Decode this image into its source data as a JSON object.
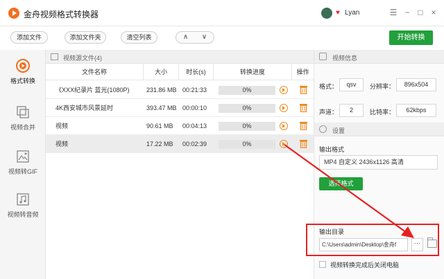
{
  "window": {
    "title": "金舟视频格式转换器",
    "username": "Lyan",
    "minimize": "−",
    "maximize": "□",
    "close": "×",
    "menu": "☰"
  },
  "toolbar": {
    "add_file": "添加文件",
    "add_folder": "添加文件夹",
    "clear_list": "清空列表",
    "move_up": "∧",
    "move_down": "∨",
    "start_convert": "开始转换"
  },
  "sidebar": {
    "items": [
      {
        "label": "格式转换",
        "icon": "convert-icon"
      },
      {
        "label": "视频合并",
        "icon": "merge-icon"
      },
      {
        "label": "视频转GIF",
        "icon": "gif-icon"
      },
      {
        "label": "视频转音频",
        "icon": "audio-icon"
      }
    ]
  },
  "source_list": {
    "header": "视频源文件(4)",
    "columns": [
      "文件名称",
      "大小",
      "时长(s)",
      "转换进度",
      "操作"
    ],
    "rows": [
      {
        "name": "《XXX纪录片 蓝光(1080P)",
        "size": "231.86 MB",
        "duration": "00:21:33",
        "progress": "0%"
      },
      {
        "name": "4K西安城市风景延时",
        "size": "393.47 MB",
        "duration": "00:00:10",
        "progress": "0%"
      },
      {
        "name": "视频",
        "size": "90.61 MB",
        "duration": "00:04:13",
        "progress": "0%"
      },
      {
        "name": "视频",
        "size": "17.22 MB",
        "duration": "00:02:39",
        "progress": "0%"
      }
    ]
  },
  "video_info": {
    "header": "视频信息",
    "format_label": "格式：",
    "format_value": "qsv",
    "resolution_label": "分辨率：",
    "resolution_value": "896x504",
    "channel_label": "声道：",
    "channel_value": "2",
    "bitrate_label": "比特率：",
    "bitrate_value": "62kbps"
  },
  "settings": {
    "header": "设置",
    "output_format_label": "输出格式",
    "output_format_value": "MP4 自定义 2436x1126 高清",
    "choose_format_button": "选择格式",
    "output_dir_label": "输出目录",
    "output_dir_value": "C:\\Users\\admin\\Desktop\\金舟f",
    "browse_button": "···",
    "shutdown_label": "视频转换完成后关闭电脑"
  },
  "colors": {
    "accent_green": "#22a03c",
    "accent_orange": "#f07020",
    "annotation_red": "#e82020"
  }
}
